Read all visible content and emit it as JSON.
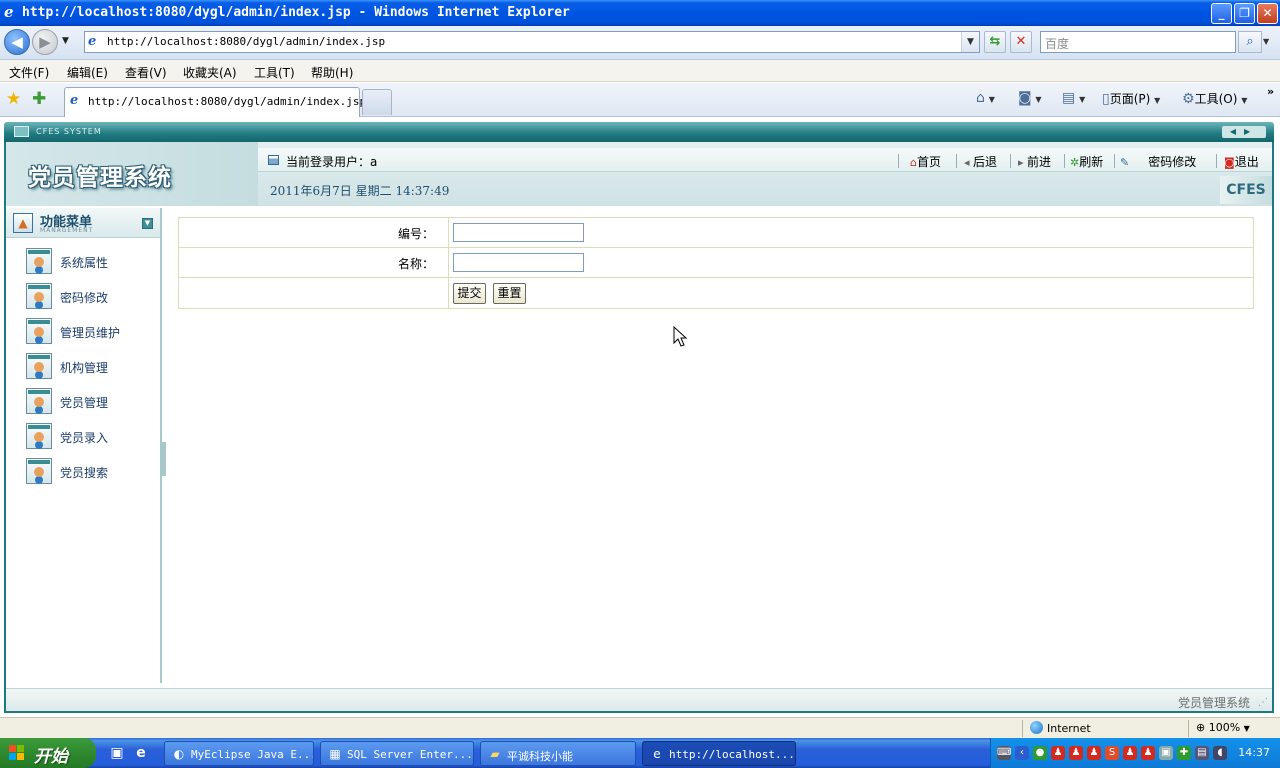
{
  "window": {
    "title": "http://localhost:8080/dygl/admin/index.jsp - Windows Internet Explorer",
    "min_symbol": "_",
    "max_symbol": "❐",
    "close_symbol": "✕"
  },
  "address_bar": {
    "url": "http://localhost:8080/dygl/admin/index.jsp",
    "search_placeholder": "百度"
  },
  "menubar": {
    "items": [
      "文件(F)",
      "编辑(E)",
      "查看(V)",
      "收藏夹(A)",
      "工具(T)",
      "帮助(H)"
    ]
  },
  "tabbar": {
    "active_tab": "http://localhost:8080/dygl/admin/index.jsp",
    "page_menu": "页面(P)",
    "tools_menu": "工具(O)"
  },
  "app": {
    "system_label": "CFES SYSTEM",
    "title": "党员管理系统",
    "current_user_label": "当前登录用户：a",
    "datetime": "2011年6月7日  星期二  14:37:49",
    "brand": "CFES",
    "top_nav": {
      "home": "首页",
      "back": "后退",
      "forward": "前进",
      "refresh": "刷新",
      "change_password": "密码修改",
      "logout": "退出"
    },
    "sidebar": {
      "title": "功能菜单",
      "subtitle": "MANAGEMENT",
      "items": [
        "系统属性",
        "密码修改",
        "管理员维护",
        "机构管理",
        "党员管理",
        "党员录入",
        "党员搜索"
      ]
    },
    "form": {
      "code_label": "编号：",
      "code_value": "",
      "name_label": "名称：",
      "name_value": "",
      "submit_label": "提交",
      "reset_label": "重置"
    },
    "footer": "党员管理系统"
  },
  "statusbar": {
    "zone": "Internet",
    "zoom": "100%"
  },
  "taskbar": {
    "start_label": "开始",
    "tasks": [
      "MyEclipse Java E...",
      "SQL Server Enter...",
      "平诚科技小能",
      "http://localhost..."
    ],
    "clock": "14:37"
  },
  "colors": {
    "app_teal": "#1f7a80",
    "ie_titlebar": "#0054e3",
    "taskbar_blue": "#245edb",
    "start_green": "#2f8a2f"
  }
}
